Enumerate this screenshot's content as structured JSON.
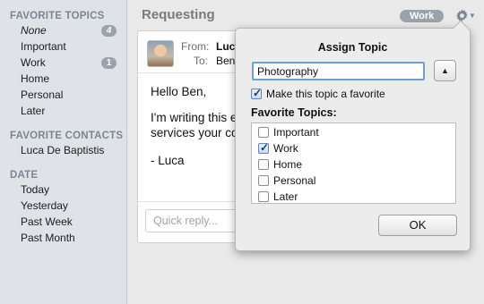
{
  "sidebar": {
    "topics_header": "FAVORITE TOPICS",
    "topics": [
      {
        "label": "None",
        "count": "4"
      },
      {
        "label": "Important",
        "count": ""
      },
      {
        "label": "Work",
        "count": "1"
      },
      {
        "label": "Home",
        "count": ""
      },
      {
        "label": "Personal",
        "count": ""
      },
      {
        "label": "Later",
        "count": ""
      }
    ],
    "contacts_header": "FAVORITE CONTACTS",
    "contacts": [
      {
        "label": "Luca De Baptistis"
      }
    ],
    "date_header": "DATE",
    "dates": [
      {
        "label": "Today"
      },
      {
        "label": "Yesterday"
      },
      {
        "label": "Past Week"
      },
      {
        "label": "Past Month"
      }
    ]
  },
  "main": {
    "title": "Requesting",
    "topic_badge": "Work",
    "gear_icon": "gear-icon",
    "message": {
      "from_label": "From:",
      "from_value": "Luca",
      "to_label": "To:",
      "to_value": "Ben",
      "body": [
        "Hello Ben,",
        "I'm writing this e",
        "services your co",
        "- Luca"
      ]
    },
    "reply_placeholder": "Quick reply..."
  },
  "popover": {
    "title": "Assign Topic",
    "topic_value": "Photography",
    "expand_icon": "▲",
    "favorite_label": "Make this topic a favorite",
    "favorite_checked": true,
    "favorites_heading": "Favorite Topics:",
    "favorites": [
      {
        "label": "Important",
        "checked": false
      },
      {
        "label": "Work",
        "checked": true
      },
      {
        "label": "Home",
        "checked": false
      },
      {
        "label": "Personal",
        "checked": false
      },
      {
        "label": "Later",
        "checked": false
      }
    ],
    "ok_label": "OK"
  },
  "colors": {
    "sidebar_bg": "#dfe3e8",
    "header_text": "#7b8692",
    "badge": "#9aa2ab",
    "focus_ring": "#6f9fd8"
  }
}
